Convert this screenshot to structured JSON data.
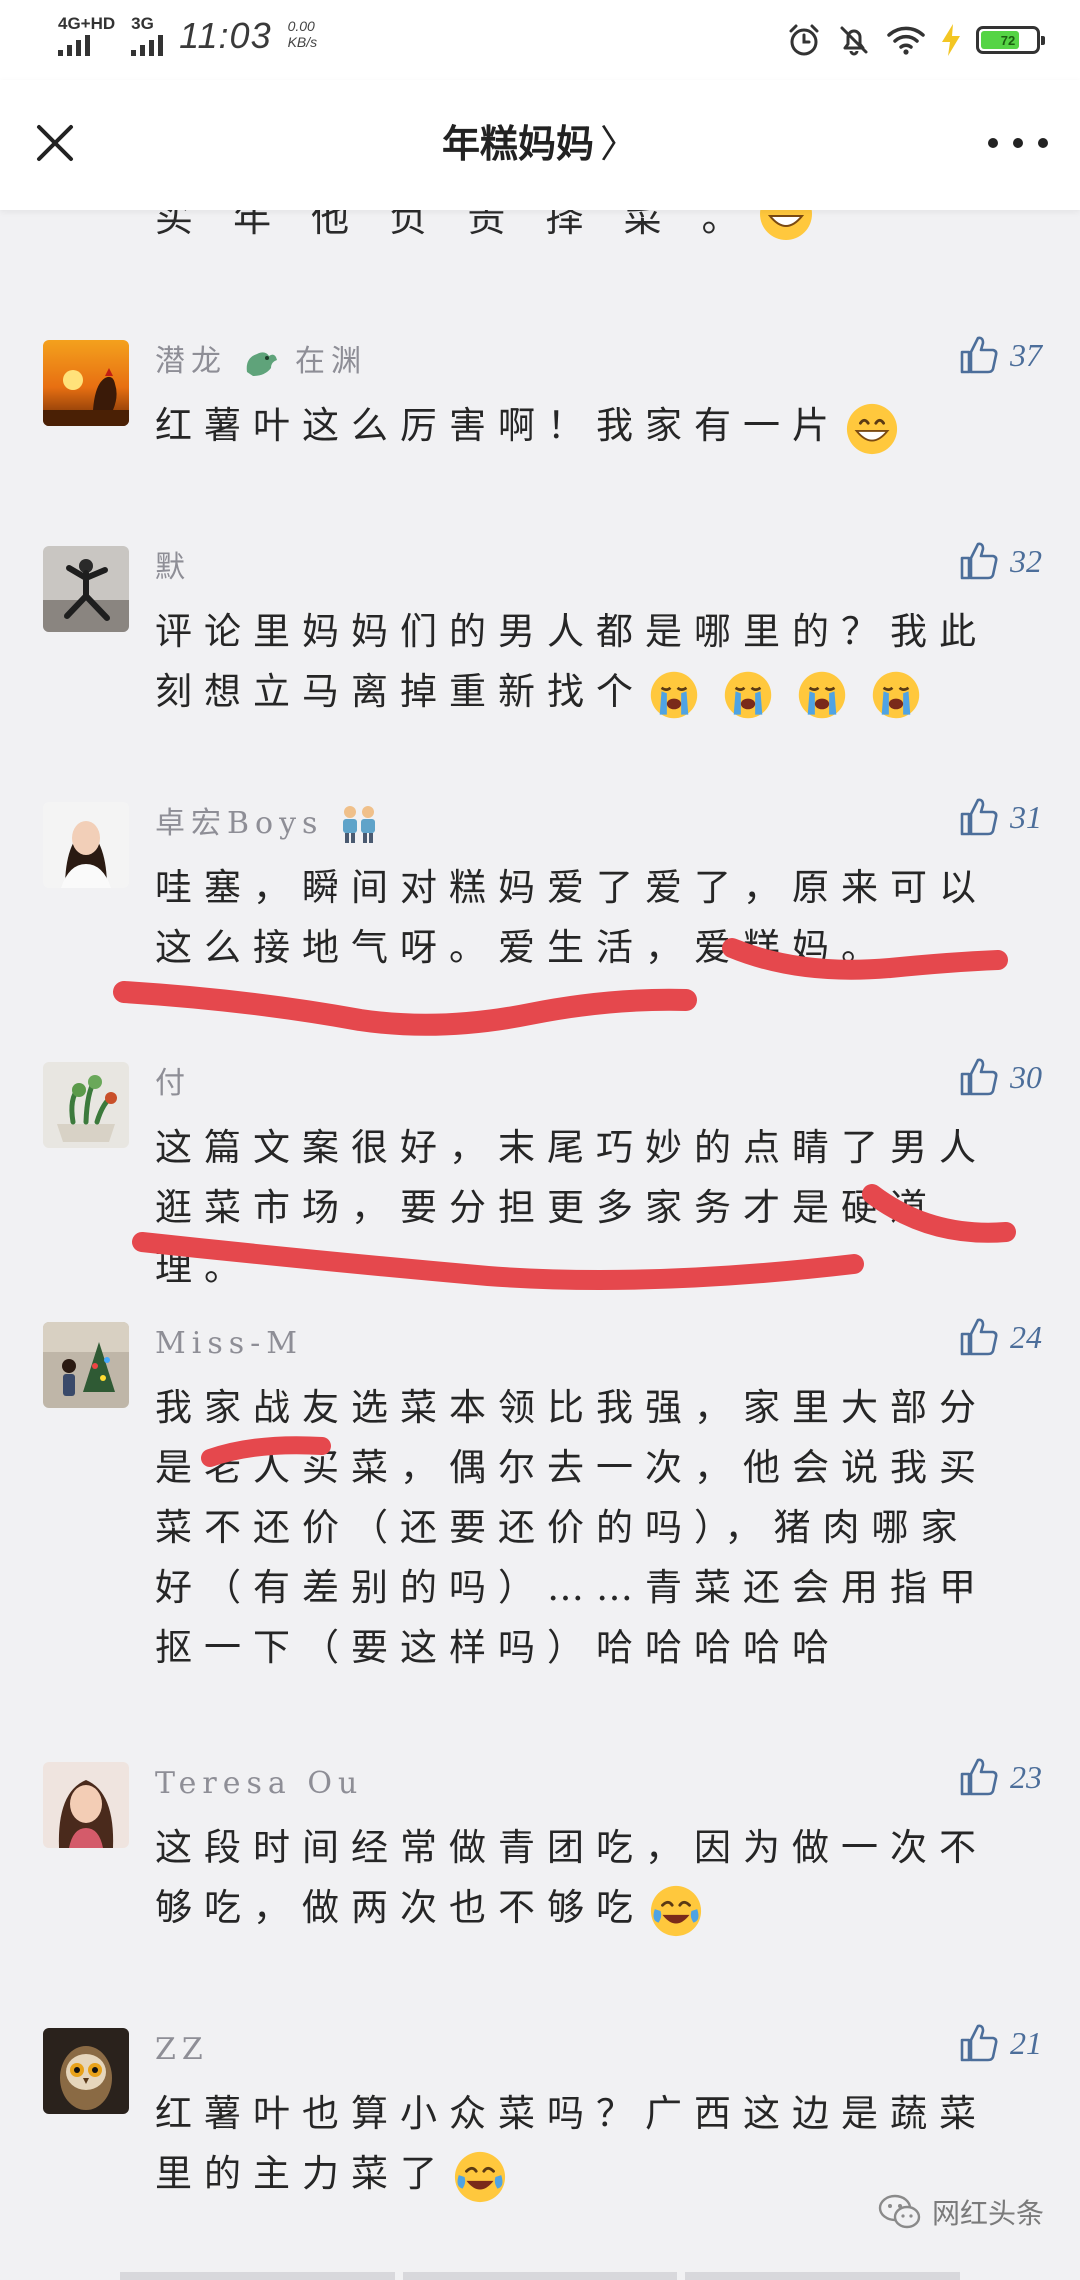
{
  "status_bar": {
    "network1": "4G+HD",
    "network2": "3G",
    "time": "11:03",
    "speed_value": "0.00",
    "speed_unit": "KB/s",
    "battery_text": "72",
    "battery_level": 0.72
  },
  "nav": {
    "title": "年糕妈妈",
    "chevron": "〉"
  },
  "partial_comment": {
    "text": "买 年 他 负 责 择 菜 。"
  },
  "comments": [
    {
      "username": "潜龙",
      "username_suffix": "在渊",
      "likes": "37",
      "text": "红薯叶这么厉害啊！我家有一片",
      "emoji": [
        "grin"
      ]
    },
    {
      "username": "默",
      "username_suffix": "",
      "likes": "32",
      "text": "评论里妈妈们的男人都是哪里的？我此刻想立马离掉重新找个",
      "emoji": [
        "cry",
        "cry",
        "cry",
        "cry"
      ]
    },
    {
      "username": "卓宏Boys",
      "username_suffix": "",
      "likes": "31",
      "text": "哇塞，瞬间对糕妈爱了爱了，原来可以这么接地气呀。爱生活，爱糕妈。",
      "emoji": []
    },
    {
      "username": "付",
      "username_suffix": "",
      "likes": "30",
      "text": "这篇文案很好，末尾巧妙的点睛了男人逛菜市场，要分担更多家务才是硬道理。",
      "emoji": []
    },
    {
      "username": "Miss-M",
      "username_suffix": "",
      "likes": "24",
      "text": "我家战友选菜本领比我强，家里大部分是老人买菜，偶尔去一次，他会说我买菜不还价（还要还价的吗），猪肉哪家好（有差别的吗）……青菜还会用指甲抠一下（要这样吗）哈哈哈哈哈",
      "emoji": []
    },
    {
      "username": "Teresa Ou",
      "username_suffix": "",
      "likes": "23",
      "text": "这段时间经常做青团吃，因为做一次不够吃，做两次也不够吃",
      "emoji": [
        "joy"
      ]
    },
    {
      "username": "ZZ",
      "username_suffix": "",
      "likes": "21",
      "text": "红薯叶也算小众菜吗？广西这边是蔬菜里的主力菜了",
      "emoji": [
        "joy"
      ]
    }
  ],
  "watermark": "网红头条",
  "colors": {
    "background": "#f1f1f3",
    "like_blue": "#4c6e9a",
    "underline_red": "#e5484d"
  }
}
